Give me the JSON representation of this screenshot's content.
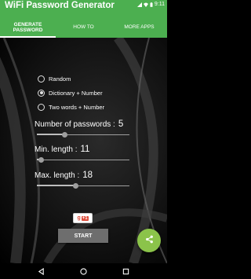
{
  "app": {
    "title": "WiFi Password Generator"
  },
  "status": {
    "time": "9:11",
    "battery_icon": "battery-icon",
    "wifi_icon": "wifi-icon",
    "signal_icon": "signal-icon"
  },
  "tabs": [
    {
      "label": "GENERATE PASSWORD",
      "active": true
    },
    {
      "label": "HOW TO",
      "active": false
    },
    {
      "label": "MORE APPS",
      "active": false
    }
  ],
  "options": [
    {
      "label": "Random",
      "checked": false
    },
    {
      "label": "Dictionary + Number",
      "checked": true
    },
    {
      "label": "Two words + Number",
      "checked": false
    }
  ],
  "fields": {
    "number_of_passwords": {
      "label": "Number of passwords :",
      "value": "5",
      "fraction": 0.3
    },
    "min_length": {
      "label": "Min. length :",
      "value": "11",
      "fraction": 0.05
    },
    "max_length": {
      "label": "Max. length :",
      "value": "18",
      "fraction": 0.42
    }
  },
  "gplus": {
    "g": "g",
    "plus_one": "+1"
  },
  "start_label": "START",
  "colors": {
    "accent": "#4caf50",
    "fab": "#8bc34a",
    "button": "#6e6e6e"
  }
}
